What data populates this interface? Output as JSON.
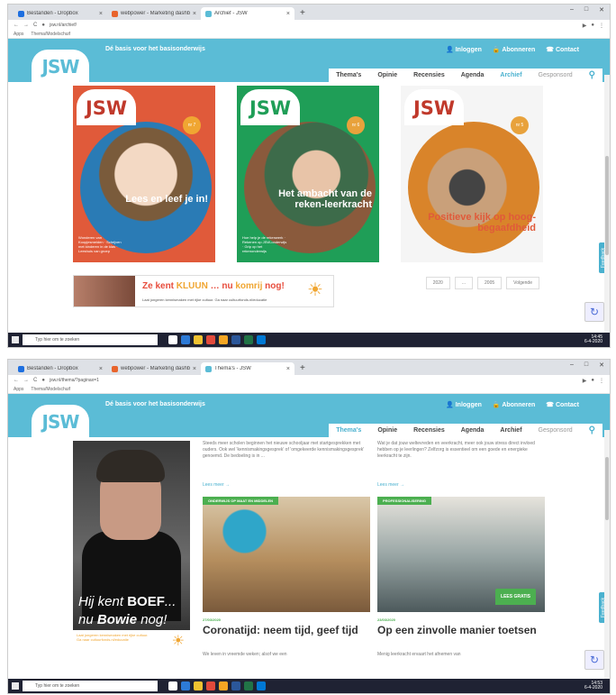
{
  "screen1": {
    "tabs": [
      {
        "label": "Bestanden - Dropbox",
        "icon": "dropbox-icon",
        "color": "#1e6fe0"
      },
      {
        "label": "webpower - Marketing dashboard",
        "icon": "webpower-icon",
        "color": "#e8642c"
      },
      {
        "label": "Archief - JSW",
        "icon": "jsw-icon",
        "color": "#5bbcd6"
      }
    ],
    "url": "jsw.nl/archief/",
    "bookmarks": [
      "Apps",
      "Thema/Modelschuif"
    ],
    "site": {
      "logo": "JSW",
      "tagline": "Dé basis voor het basisonderwijs",
      "util": [
        "Inloggen",
        "Abonneren",
        "Contact"
      ],
      "nav": [
        "Thema's",
        "Opinie",
        "Recensies",
        "Agenda",
        "Archief",
        "Gesponsord"
      ],
      "nav_active": "Archief"
    },
    "covers": [
      {
        "logo": "JSW",
        "num": "nr 7",
        "title": "Lees en leef je in!",
        "small": "Wonderen van Koopjesmeiden · Schrijven met kinderen in de klas · Leeshuis van groep"
      },
      {
        "logo": "JSW",
        "num": "nr 6",
        "title": "Het ambacht van de reken-leerkracht",
        "small": "Hoe help je de rekenwerk · Rekenen op JSW-onderwijs · Grip op het rekenonderwijs"
      },
      {
        "logo": "JSW",
        "num": "nr 5",
        "title": "Positieve kijk op hoog-begaafdheid",
        "small": ""
      }
    ],
    "ad": {
      "text_a": "Ze kent",
      "text_b": "KLUUN",
      "text_c": "nu",
      "text_d": "komrij",
      "text_e": "nog!",
      "sub": "Laat jongeren kennismaken met rijke cultuur. Ga naar cultuurfonds.nl/educatie"
    },
    "pager": [
      "2020",
      "...",
      "2005",
      "Volgende"
    ],
    "feedback": "Feedback",
    "taskbar_search": "Typ hier om te zoeken",
    "clock": "14:45",
    "date": "6-4-2020"
  },
  "screen2": {
    "tabs": [
      {
        "label": "Bestanden - Dropbox",
        "icon": "dropbox-icon",
        "color": "#1e6fe0"
      },
      {
        "label": "webpower - Marketing dashboard",
        "icon": "webpower-icon",
        "color": "#e8642c"
      },
      {
        "label": "Thema's - JSW",
        "icon": "jsw-icon",
        "color": "#5bbcd6"
      }
    ],
    "url": "jsw.nl/thema/?paginax=1",
    "bookmarks": [
      "Apps",
      "Thema/Modelschuif"
    ],
    "site": {
      "logo": "JSW",
      "tagline": "Dé basis voor het basisonderwijs",
      "util": [
        "Inloggen",
        "Abonneren",
        "Contact"
      ],
      "nav": [
        "Thema's",
        "Opinie",
        "Recensies",
        "Agenda",
        "Archief",
        "Gesponsord"
      ],
      "nav_active": "Thema's"
    },
    "left_ad": {
      "line1a": "Hij kent",
      "line1b": "BOEF",
      "line1c": "...",
      "line2a": "nu",
      "line2b": "Bowie",
      "line2c": "nog!",
      "small": "Laat jongeren kennismaken met rijke cultuur. Ga naar cultuurfonds.nl/educatie"
    },
    "intros": [
      {
        "text": "Steeds meer scholen beginnen het nieuwe schooljaar met startgesprekken met ouders. Ook wel 'kennismakingsgesprek' of 'omgekeerde kennismakingsgesprek' genoemd. De bedoeling is in ...",
        "more": "Lees meer"
      },
      {
        "text": "Wat je dat jouw weltevreden en veerkracht, meer ook jouw stress direct invloed hebben op je leerlingen? Zelfzorg is essentieel om een goede en energieke leerkracht te zijn.",
        "more": "Lees meer"
      }
    ],
    "articles": [
      {
        "label": "ONDERWIJS OP MAAT EN MIDDELEN",
        "date": "27/03/2020",
        "title": "Coronatijd: neem tijd, geef tijd",
        "sub": "We leven in vreemde weken; alsof we een"
      },
      {
        "label": "PROFESSIONALISERING",
        "date": "23/03/2020",
        "title": "Op een zinvolle manier toetsen",
        "sub": "Menig leerkracht ervaart het afnemen van",
        "badge": "LEES GRATIS"
      }
    ],
    "feedback": "Feedback",
    "taskbar_search": "Typ hier om te zoeken",
    "clock": "14:53",
    "date": "6-4-2020"
  }
}
